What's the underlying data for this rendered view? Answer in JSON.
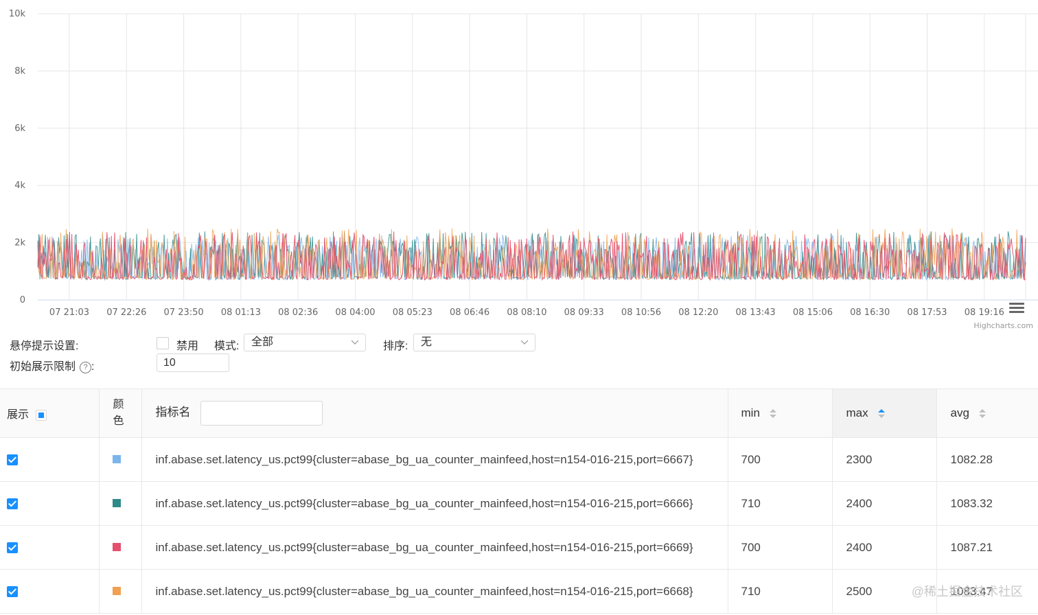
{
  "chart_data": {
    "type": "line",
    "title": "",
    "xlabel": "",
    "ylabel": "",
    "ylim": [
      0,
      10000
    ],
    "y_ticks": [
      "10k",
      "8k",
      "6k",
      "4k",
      "2k",
      "0"
    ],
    "y_tick_values": [
      10000,
      8000,
      6000,
      4000,
      2000,
      0
    ],
    "x_ticks": [
      "07 21:03",
      "07 22:26",
      "07 23:50",
      "08 01:13",
      "08 02:36",
      "08 04:00",
      "08 05:23",
      "08 06:46",
      "08 08:10",
      "08 09:33",
      "08 10:56",
      "08 12:20",
      "08 13:43",
      "08 15:06",
      "08 16:30",
      "08 17:53",
      "08 19:16"
    ],
    "grid": true,
    "series": [
      {
        "color": "#7cb5ec",
        "min": 700,
        "max": 2300,
        "typical_baseline": 750
      },
      {
        "color": "#2f8a8a",
        "min": 710,
        "max": 2400,
        "typical_baseline": 760
      },
      {
        "color": "#e4506e",
        "min": 700,
        "max": 2400,
        "typical_baseline": 750
      },
      {
        "color": "#f0a050",
        "min": 710,
        "max": 2500,
        "typical_baseline": 760
      }
    ]
  },
  "chart": {
    "credit": "Highcharts.com",
    "menu_icon": "hamburger-menu-icon"
  },
  "settings": {
    "tooltip_label": "悬停提示设置:",
    "disable_label": "禁用",
    "disable_checked": false,
    "mode_label": "模式:",
    "mode_value": "全部",
    "sort_label": "排序:",
    "sort_value": "无",
    "limit_label": "初始展示限制",
    "limit_colon": ":",
    "limit_value": "10",
    "help_icon": "question-circle-icon"
  },
  "table": {
    "headers": {
      "show": "展示",
      "color": "颜色",
      "name": "指标名",
      "min": "min",
      "max": "max",
      "avg": "avg"
    },
    "rows": [
      {
        "checked": true,
        "color": "#7cb5ec",
        "name": "inf.abase.set.latency_us.pct99{cluster=abase_bg_ua_counter_mainfeed,host=n154-016-215,port=6667}",
        "min": "700",
        "max": "2300",
        "avg": "1082.28"
      },
      {
        "checked": true,
        "color": "#2f8a8a",
        "name": "inf.abase.set.latency_us.pct99{cluster=abase_bg_ua_counter_mainfeed,host=n154-016-215,port=6666}",
        "min": "710",
        "max": "2400",
        "avg": "1083.32"
      },
      {
        "checked": true,
        "color": "#e4506e",
        "name": "inf.abase.set.latency_us.pct99{cluster=abase_bg_ua_counter_mainfeed,host=n154-016-215,port=6669}",
        "min": "700",
        "max": "2400",
        "avg": "1087.21"
      },
      {
        "checked": true,
        "color": "#f0a050",
        "name": "inf.abase.set.latency_us.pct99{cluster=abase_bg_ua_counter_mainfeed,host=n154-016-215,port=6668}",
        "min": "710",
        "max": "2500",
        "avg": "1083.47"
      }
    ]
  },
  "watermark": "@稀土掘金技术社区"
}
